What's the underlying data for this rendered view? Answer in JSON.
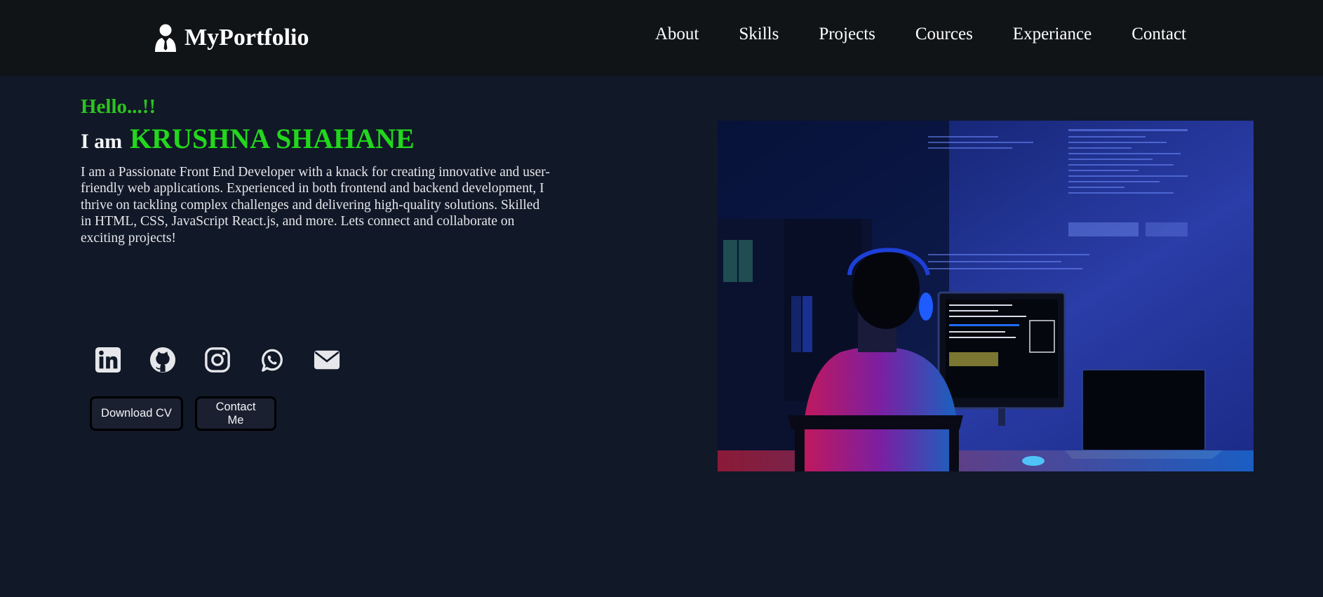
{
  "brand": {
    "name": "MyPortfolio",
    "icon": "user-tie-icon"
  },
  "nav": {
    "links": [
      "About",
      "Skills",
      "Projects",
      "Cources",
      "Experiance",
      "Contact"
    ]
  },
  "hero": {
    "greeting": "Hello...!!",
    "intro_prefix": "I am",
    "name": "KRUSHNA SHAHANE",
    "bio": "I am a Passionate Front End Developer with a knack for creating innovative and user-friendly web applications. Experienced in both frontend and backend development, I thrive on tackling complex challenges and delivering high-quality solutions. Skilled in HTML, CSS, JavaScript React.js, and more. Lets connect and collaborate on exciting projects!",
    "socials": [
      "linkedin-icon",
      "github-icon",
      "instagram-icon",
      "whatsapp-icon",
      "email-icon"
    ],
    "buttons": {
      "download_cv": "Download CV",
      "contact_me": "Contact Me"
    }
  },
  "colors": {
    "background": "#111827",
    "navbar": "#111417",
    "greeting": "#2cc41f",
    "name": "#22d81c",
    "button_bg": "#1a2030"
  }
}
